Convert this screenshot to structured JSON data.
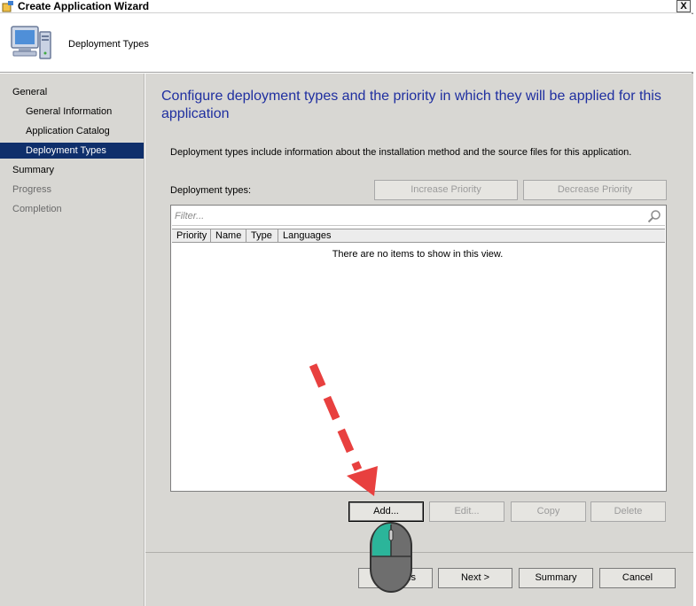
{
  "window": {
    "title": "Create Application Wizard",
    "close": "X"
  },
  "header": {
    "title": "Deployment Types"
  },
  "sidebar": {
    "items": [
      {
        "label": "General"
      },
      {
        "label": "General Information"
      },
      {
        "label": "Application Catalog"
      },
      {
        "label": "Deployment Types"
      },
      {
        "label": "Summary"
      },
      {
        "label": "Progress"
      },
      {
        "label": "Completion"
      }
    ]
  },
  "main": {
    "heading": "Configure deployment types and the priority in which they will be applied for this application",
    "description": "Deployment types include information about the installation method and the source files for this application.",
    "deployment_types_label": "Deployment types:",
    "increase_priority": "Increase Priority",
    "decrease_priority": "Decrease Priority",
    "filter_placeholder": "Filter...",
    "columns": [
      "Priority",
      "Name",
      "Type",
      "Languages"
    ],
    "empty_message": "There are no items to show in this view.",
    "add": "Add...",
    "edit": "Edit...",
    "copy": "Copy",
    "delete": "Delete"
  },
  "footer": {
    "previous": "< Previous",
    "previous_visible": "us",
    "next": "Next >",
    "summary": "Summary",
    "cancel": "Cancel"
  },
  "colors": {
    "selected_nav": "#0f2f6b",
    "heading": "#1f2fa0",
    "panel": "#d8d7d3",
    "arrow": "#e8403f",
    "mouse_highlight": "#2bb59a"
  }
}
